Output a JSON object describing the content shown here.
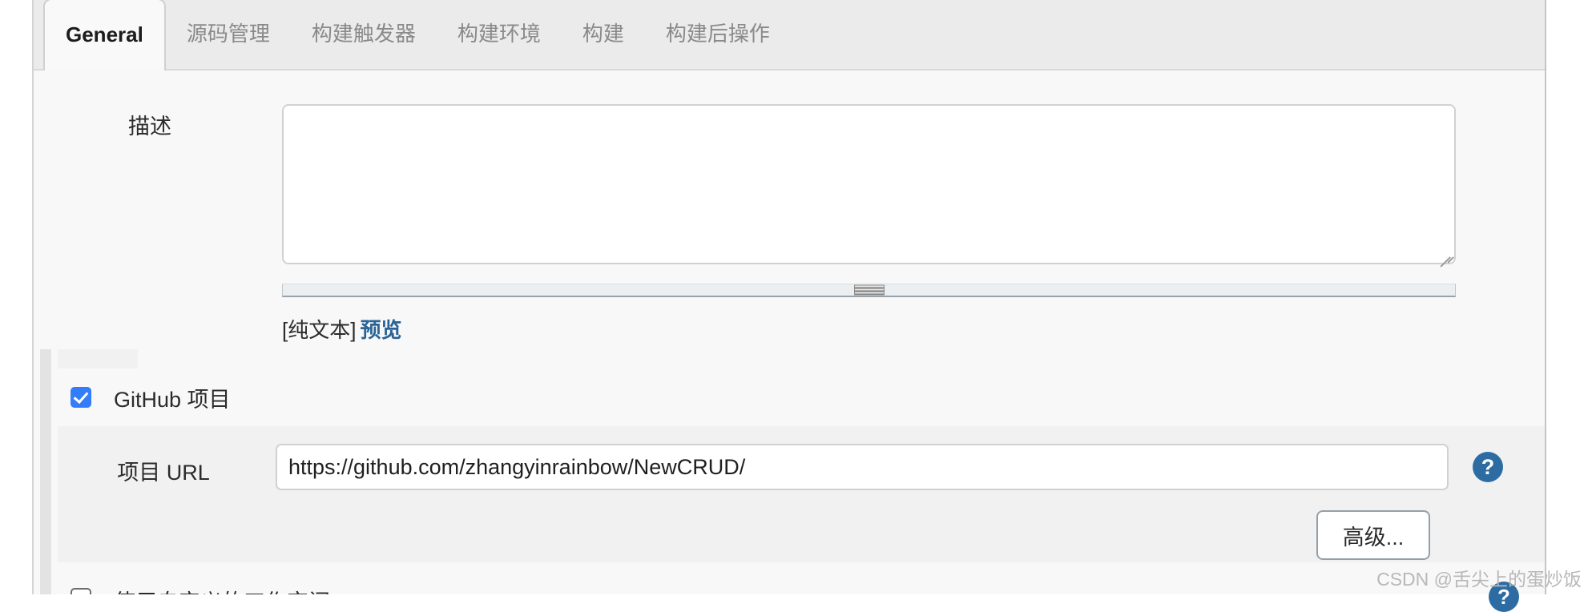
{
  "tabs": [
    {
      "label": "General",
      "active": true
    },
    {
      "label": "源码管理",
      "active": false
    },
    {
      "label": "构建触发器",
      "active": false
    },
    {
      "label": "构建环境",
      "active": false
    },
    {
      "label": "构建",
      "active": false
    },
    {
      "label": "构建后操作",
      "active": false
    }
  ],
  "description": {
    "label": "描述",
    "value": "",
    "placeholder": "",
    "format_note": "[纯文本]",
    "preview_link": "预览"
  },
  "github_project": {
    "checkbox_label": "GitHub 项目",
    "checked": true,
    "url_label": "项目 URL",
    "url_value": "https://github.com/zhangyinrainbow/NewCRUD/",
    "url_placeholder": "",
    "help_icon": "?",
    "advanced_button": "高级..."
  },
  "bottom_row": {
    "checkbox_label": "使用自定义的工作空间",
    "checked": false
  },
  "watermark": {
    "text": "CSDN @舌尖上的蛋炒饭",
    "badge": "?"
  },
  "colors": {
    "accent_blue": "#337dfa",
    "link_blue": "#2a6496",
    "help_blue": "#2d6ca2",
    "tab_bar_bg": "#ebebeb",
    "panel_bg": "#f8f8f8",
    "section_bg": "#f1f1f1"
  }
}
